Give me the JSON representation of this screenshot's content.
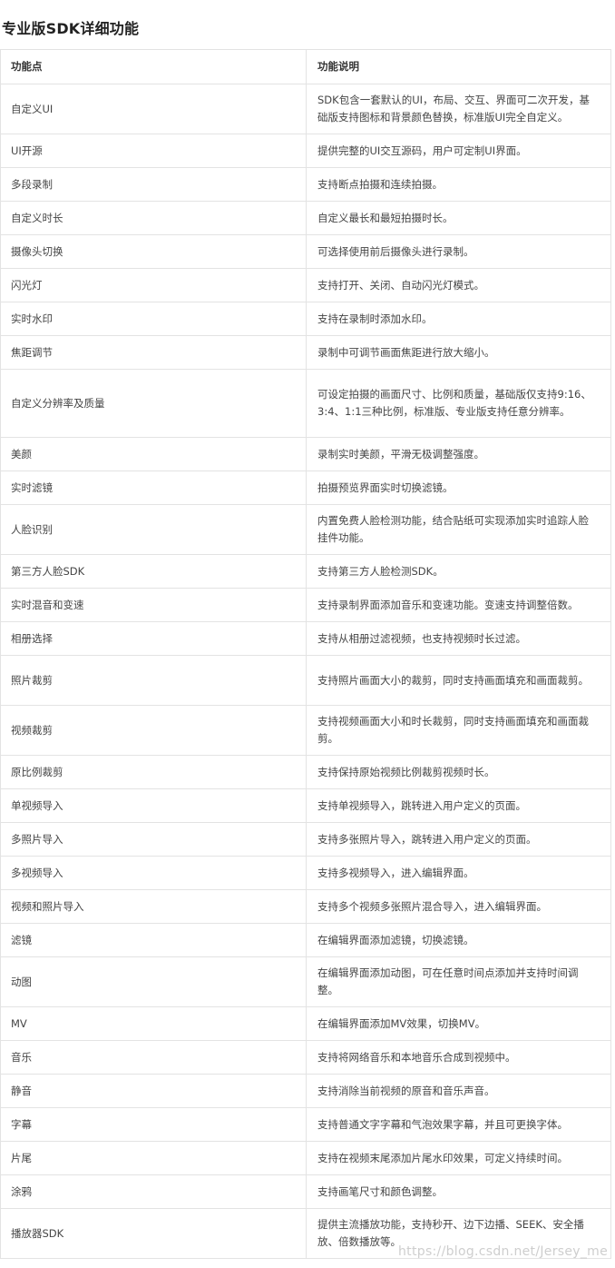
{
  "title": "专业版SDK详细功能",
  "table": {
    "headers": [
      "功能点",
      "功能说明"
    ],
    "rows": [
      [
        "自定义UI",
        "SDK包含一套默认的UI，布局、交互、界面可二次开发，基础版支持图标和背景颜色替换，标准版UI完全自定义。"
      ],
      [
        "UI开源",
        "提供完整的UI交互源码，用户可定制UI界面。"
      ],
      [
        "多段录制",
        "支持断点拍摄和连续拍摄。"
      ],
      [
        "自定义时长",
        "自定义最长和最短拍摄时长。"
      ],
      [
        "摄像头切换",
        "可选择使用前后摄像头进行录制。"
      ],
      [
        "闪光灯",
        "支持打开、关闭、自动闪光灯模式。"
      ],
      [
        "实时水印",
        "支持在录制时添加水印。"
      ],
      [
        "焦距调节",
        "录制中可调节画面焦距进行放大缩小。"
      ],
      [
        "自定义分辨率及质量",
        "可设定拍摄的画面尺寸、比例和质量，基础版仅支持9:16、3:4、1:1三种比例，标准版、专业版支持任意分辨率。"
      ],
      [
        "美颜",
        "录制实时美颜，平滑无极调整强度。"
      ],
      [
        "实时滤镜",
        "拍摄预览界面实时切换滤镜。"
      ],
      [
        "人脸识别",
        "内置免费人脸检测功能，结合贴纸可实现添加实时追踪人脸挂件功能。"
      ],
      [
        "第三方人脸SDK",
        "支持第三方人脸检测SDK。"
      ],
      [
        "实时混音和变速",
        "支持录制界面添加音乐和变速功能。变速支持调整倍数。"
      ],
      [
        "相册选择",
        "支持从相册过滤视频，也支持视频时长过滤。"
      ],
      [
        "照片裁剪",
        "支持照片画面大小的裁剪，同时支持画面填充和画面裁剪。"
      ],
      [
        "视频裁剪",
        "支持视频画面大小和时长裁剪，同时支持画面填充和画面裁剪。"
      ],
      [
        "原比例裁剪",
        "支持保持原始视频比例裁剪视频时长。"
      ],
      [
        "单视频导入",
        "支持单视频导入，跳转进入用户定义的页面。"
      ],
      [
        "多照片导入",
        "支持多张照片导入，跳转进入用户定义的页面。"
      ],
      [
        "多视频导入",
        "支持多视频导入，进入编辑界面。"
      ],
      [
        "视频和照片导入",
        "支持多个视频多张照片混合导入，进入编辑界面。"
      ],
      [
        "滤镜",
        "在编辑界面添加滤镜，切换滤镜。"
      ],
      [
        "动图",
        "在编辑界面添加动图，可在任意时间点添加并支持时间调整。"
      ],
      [
        "MV",
        "在编辑界面添加MV效果，切换MV。"
      ],
      [
        "音乐",
        "支持将网络音乐和本地音乐合成到视频中。"
      ],
      [
        "静音",
        "支持消除当前视频的原音和音乐声音。"
      ],
      [
        "字幕",
        "支持普通文字字幕和气泡效果字幕，并且可更换字体。"
      ],
      [
        "片尾",
        "支持在视频末尾添加片尾水印效果，可定义持续时间。"
      ],
      [
        "涂鸦",
        "支持画笔尺寸和颜色调整。"
      ],
      [
        "播放器SDK",
        "提供主流播放功能，支持秒开、边下边播、SEEK、安全播放、倍数播放等。"
      ]
    ]
  },
  "watermark": "https://blog.csdn.net/Jersey_me"
}
